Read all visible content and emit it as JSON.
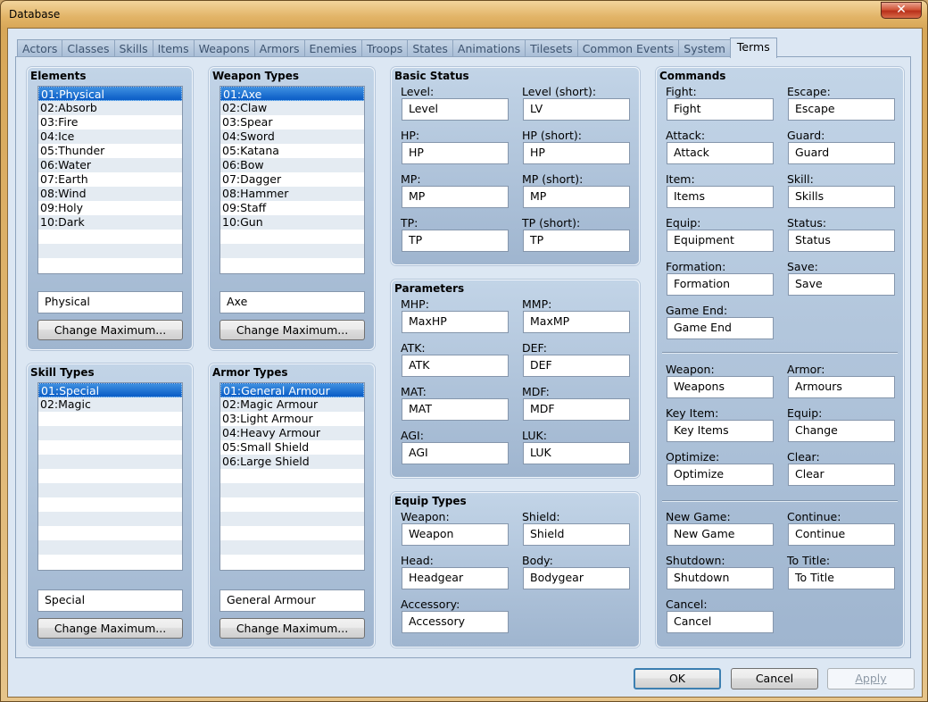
{
  "window": {
    "title": "Database",
    "close_icon": "close-icon"
  },
  "tabs": [
    {
      "label": "Actors",
      "active": false
    },
    {
      "label": "Classes",
      "active": false
    },
    {
      "label": "Skills",
      "active": false
    },
    {
      "label": "Items",
      "active": false
    },
    {
      "label": "Weapons",
      "active": false
    },
    {
      "label": "Armors",
      "active": false
    },
    {
      "label": "Enemies",
      "active": false
    },
    {
      "label": "Troops",
      "active": false
    },
    {
      "label": "States",
      "active": false
    },
    {
      "label": "Animations",
      "active": false
    },
    {
      "label": "Tilesets",
      "active": false
    },
    {
      "label": "Common Events",
      "active": false
    },
    {
      "label": "System",
      "active": false
    },
    {
      "label": "Terms",
      "active": true
    }
  ],
  "elements": {
    "title": "Elements",
    "items": [
      "01:Physical",
      "02:Absorb",
      "03:Fire",
      "04:Ice",
      "05:Thunder",
      "06:Water",
      "07:Earth",
      "08:Wind",
      "09:Holy",
      "10:Dark"
    ],
    "selected_index": 0,
    "name_value": "Physical",
    "change_max_label": "Change Maximum..."
  },
  "weapon_types": {
    "title": "Weapon Types",
    "items": [
      "01:Axe",
      "02:Claw",
      "03:Spear",
      "04:Sword",
      "05:Katana",
      "06:Bow",
      "07:Dagger",
      "08:Hammer",
      "09:Staff",
      "10:Gun"
    ],
    "selected_index": 0,
    "name_value": "Axe",
    "change_max_label": "Change Maximum..."
  },
  "skill_types": {
    "title": "Skill Types",
    "items": [
      "01:Special",
      "02:Magic"
    ],
    "selected_index": 0,
    "name_value": "Special",
    "change_max_label": "Change Maximum..."
  },
  "armor_types": {
    "title": "Armor Types",
    "items": [
      "01:General Armour",
      "02:Magic Armour",
      "03:Light Armour",
      "04:Heavy Armour",
      "05:Small Shield",
      "06:Large Shield"
    ],
    "selected_index": 0,
    "name_value": "General Armour",
    "change_max_label": "Change Maximum..."
  },
  "basic_status": {
    "title": "Basic Status",
    "fields": [
      {
        "label": "Level:",
        "value": "Level"
      },
      {
        "label": "Level (short):",
        "value": "LV"
      },
      {
        "label": "HP:",
        "value": "HP"
      },
      {
        "label": "HP (short):",
        "value": "HP"
      },
      {
        "label": "MP:",
        "value": "MP"
      },
      {
        "label": "MP (short):",
        "value": "MP"
      },
      {
        "label": "TP:",
        "value": "TP"
      },
      {
        "label": "TP (short):",
        "value": "TP"
      }
    ]
  },
  "parameters": {
    "title": "Parameters",
    "fields": [
      {
        "label": "MHP:",
        "value": "MaxHP"
      },
      {
        "label": "MMP:",
        "value": "MaxMP"
      },
      {
        "label": "ATK:",
        "value": "ATK"
      },
      {
        "label": "DEF:",
        "value": "DEF"
      },
      {
        "label": "MAT:",
        "value": "MAT"
      },
      {
        "label": "MDF:",
        "value": "MDF"
      },
      {
        "label": "AGI:",
        "value": "AGI"
      },
      {
        "label": "LUK:",
        "value": "LUK"
      }
    ]
  },
  "equip_types": {
    "title": "Equip Types",
    "fields": [
      {
        "label": "Weapon:",
        "value": "Weapon"
      },
      {
        "label": "Shield:",
        "value": "Shield"
      },
      {
        "label": "Head:",
        "value": "Headgear"
      },
      {
        "label": "Body:",
        "value": "Bodygear"
      },
      {
        "label": "Accessory:",
        "value": "Accessory"
      }
    ]
  },
  "commands": {
    "title": "Commands",
    "fields": [
      {
        "label": "Fight:",
        "value": "Fight"
      },
      {
        "label": "Escape:",
        "value": "Escape"
      },
      {
        "label": "Attack:",
        "value": "Attack"
      },
      {
        "label": "Guard:",
        "value": "Guard"
      },
      {
        "label": "Item:",
        "value": "Items"
      },
      {
        "label": "Skill:",
        "value": "Skills"
      },
      {
        "label": "Equip:",
        "value": "Equipment"
      },
      {
        "label": "Status:",
        "value": "Status"
      },
      {
        "label": "Formation:",
        "value": "Formation"
      },
      {
        "label": "Save:",
        "value": "Save"
      },
      {
        "label": "Game End:",
        "value": "Game End"
      },
      {
        "label": "Weapon:",
        "value": "Weapons"
      },
      {
        "label": "Armor:",
        "value": "Armours"
      },
      {
        "label": "Key Item:",
        "value": "Key Items"
      },
      {
        "label": "Equip:",
        "value": "Change"
      },
      {
        "label": "Optimize:",
        "value": "Optimize"
      },
      {
        "label": "Clear:",
        "value": "Clear"
      },
      {
        "label": "New Game:",
        "value": "New Game"
      },
      {
        "label": "Continue:",
        "value": "Continue"
      },
      {
        "label": "Shutdown:",
        "value": "Shutdown"
      },
      {
        "label": "To Title:",
        "value": "To Title"
      },
      {
        "label": "Cancel:",
        "value": "Cancel"
      }
    ]
  },
  "footer": {
    "ok_label": "OK",
    "cancel_label": "Cancel",
    "apply_label": "Apply"
  }
}
